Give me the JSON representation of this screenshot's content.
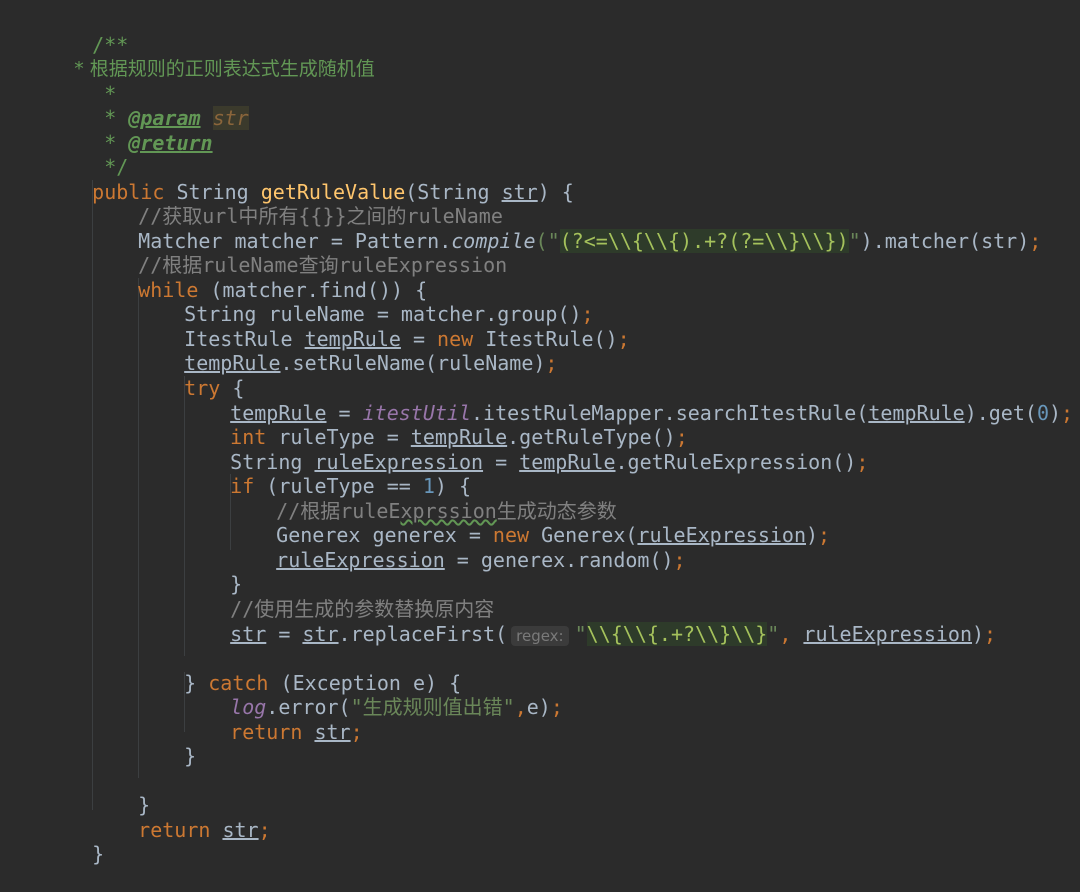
{
  "editor": {
    "doc_comment": {
      "open": "/**",
      "desc": " * 根据规则的正则表达式生成随机值",
      "blank": " *",
      "star": " * ",
      "param_tag": "@param",
      "param_name": "str",
      "return_tag": "@return",
      "close": " */"
    },
    "signature": {
      "public": "public",
      "ret_type": " String ",
      "name": "getRuleValue",
      "params_open": "(String ",
      "param": "str",
      "params_close": ") {"
    },
    "comment_url": "//获取url中所有{{}}之间的ruleName",
    "matcher_line": {
      "decl": "Matcher matcher = Pattern.",
      "method": "compile",
      "paren_open": "(\"",
      "regex": "(?<=\\\\{\\\\{).+?(?=\\\\}\\\\})",
      "tail_quote": "\"",
      "tail": ").matcher(str)",
      "semi": ";"
    },
    "comment_query": "//根据ruleName查询ruleExpression",
    "while_line": {
      "kw": "while",
      "rest": " (matcher.find()) {"
    },
    "rulename_line": {
      "text": "String ruleName = matcher.group()",
      "semi": ";"
    },
    "temprule_decl": {
      "type": "ItestRule ",
      "var": "tempRule",
      "eq": " = ",
      "kw_new": "new",
      "rest": " ItestRule()",
      "semi": ";"
    },
    "setrulename_line": {
      "var": "tempRule",
      "rest": ".setRuleName(ruleName)",
      "semi": ";"
    },
    "try_line": {
      "kw": "try",
      "rest": " {"
    },
    "search_line": {
      "var": "tempRule",
      "eq": " = ",
      "util": "itestUtil",
      "mid": ".itestRuleMapper.searchItestRule(",
      "arg": "tempRule",
      "after": ").get(",
      "num": "0",
      "close": ")",
      "semi": ";"
    },
    "ruletype_line": {
      "kw": "int",
      "mid": " ruleType = ",
      "var": "tempRule",
      "rest": ".getRuleType()",
      "semi": ";"
    },
    "ruleexpr_line": {
      "type": "String ",
      "var": "ruleExpression",
      "eq": " = ",
      "temp": "tempRule",
      "rest": ".getRuleExpression()",
      "semi": ";"
    },
    "if_line": {
      "kw": "if",
      "mid": " (ruleType == ",
      "num": "1",
      "rest": ") {"
    },
    "comment_generex": {
      "prefix": "//根据ruleE",
      "wavy": "xprssion",
      "suffix": "生成动态参数"
    },
    "generex_line": {
      "type": "Generex generex = ",
      "kw_new": "new",
      "mid": " Generex(",
      "arg": "ruleExpression",
      "close": ")",
      "semi": ";"
    },
    "random_line": {
      "var": "ruleExpression",
      "rest": " = generex.random()",
      "semi": ";"
    },
    "brace_close_if": "}",
    "comment_replace": "//使用生成的参数替换原内容",
    "replace_line": {
      "var": "str",
      "eq": " = ",
      "obj": "str",
      "method": ".replaceFirst(",
      "hint": "regex:",
      "quote_open": "\"",
      "regex": "\\\\{\\\\{.+?\\\\}\\\\}",
      "quote_close": "\"",
      "comma": ", ",
      "arg": "ruleExpression",
      "close": ")",
      "semi": ";"
    },
    "catch_line": {
      "brace": "} ",
      "kw": "catch",
      "rest": " (Exception e) {"
    },
    "log_line": {
      "log": "log",
      "mid": ".error(",
      "str": "\"生成规则值出错\"",
      "comma": ",",
      "rest": "e)",
      "semi": ";"
    },
    "return_inner": {
      "kw": "return",
      "sp": " ",
      "var": "str",
      "semi": ";"
    },
    "brace_close_catch": "}",
    "brace_close_while": "}",
    "return_outer": {
      "kw": "return",
      "sp": " ",
      "var": "str",
      "semi": ";"
    },
    "brace_close_method": "}"
  }
}
